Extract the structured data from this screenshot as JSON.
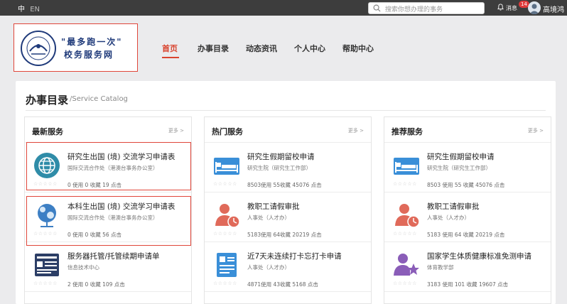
{
  "topbar": {
    "lang_zh": "中",
    "lang_en": "EN",
    "search_placeholder": "搜索你想办理的事务",
    "msg_label": "消息",
    "msg_count": "14",
    "username": "高境鸿"
  },
  "logo": {
    "line1": "\"最多跑一次\"",
    "line2": "校务服务网"
  },
  "nav": [
    "首页",
    "办事目录",
    "动态资讯",
    "个人中心",
    "帮助中心"
  ],
  "catalog": {
    "title": "办事目录",
    "subtitle": "/Service Catalog"
  },
  "columns": [
    {
      "title": "最新服务",
      "more": "更多 >",
      "cards": [
        {
          "icon": "globe-icon",
          "title": "研究生出国 (境) 交流学习申请表",
          "dept": "国际交流合作处（港澳台事务办公室）",
          "stats": "0 使用 0 收藏 19 点击"
        },
        {
          "icon": "network-globe-icon",
          "title": "本科生出国 (境) 交流学习申请表",
          "dept": "国际交流合作处（港澳台事务办公室）",
          "stats": "0 使用 0 收藏 56 点击"
        },
        {
          "icon": "server-icon",
          "title": "服务器托管/托管续期申请单",
          "dept": "信息技术中心",
          "stats": "2 使用 0 收藏 109 点击"
        }
      ]
    },
    {
      "title": "热门服务",
      "more": "更多 >",
      "cards": [
        {
          "icon": "bed-icon",
          "title": "研究生假期留校申请",
          "dept": "研究生院（研究生工作部）",
          "stats": "8503使用 55收藏 45076 点击"
        },
        {
          "icon": "person-clock-icon",
          "title": "教职工请假审批",
          "dept": "人事处（人才办）",
          "stats": "5183使用 64收藏 20219 点击"
        },
        {
          "icon": "id-card-icon",
          "title": "近7天未连续打卡忘打卡申请",
          "dept": "人事处（人才办）",
          "stats": "4871使用 43收藏 5168 点击"
        }
      ]
    },
    {
      "title": "推荐服务",
      "more": "更多 >",
      "cards": [
        {
          "icon": "bed-icon",
          "title": "研究生假期留校申请",
          "dept": "研究生院（研究生工作部）",
          "stats": "8503 使用 55 收藏 45076 点击"
        },
        {
          "icon": "person-clock-icon",
          "title": "教职工请假审批",
          "dept": "人事处（人才办）",
          "stats": "5183 使用 64 收藏 20219 点击"
        },
        {
          "icon": "person-star-icon",
          "title": "国家学生体质健康标准免测申请",
          "dept": "体育教学部",
          "stats": "3183 使用 101 收藏 19607 点击"
        }
      ]
    }
  ]
}
